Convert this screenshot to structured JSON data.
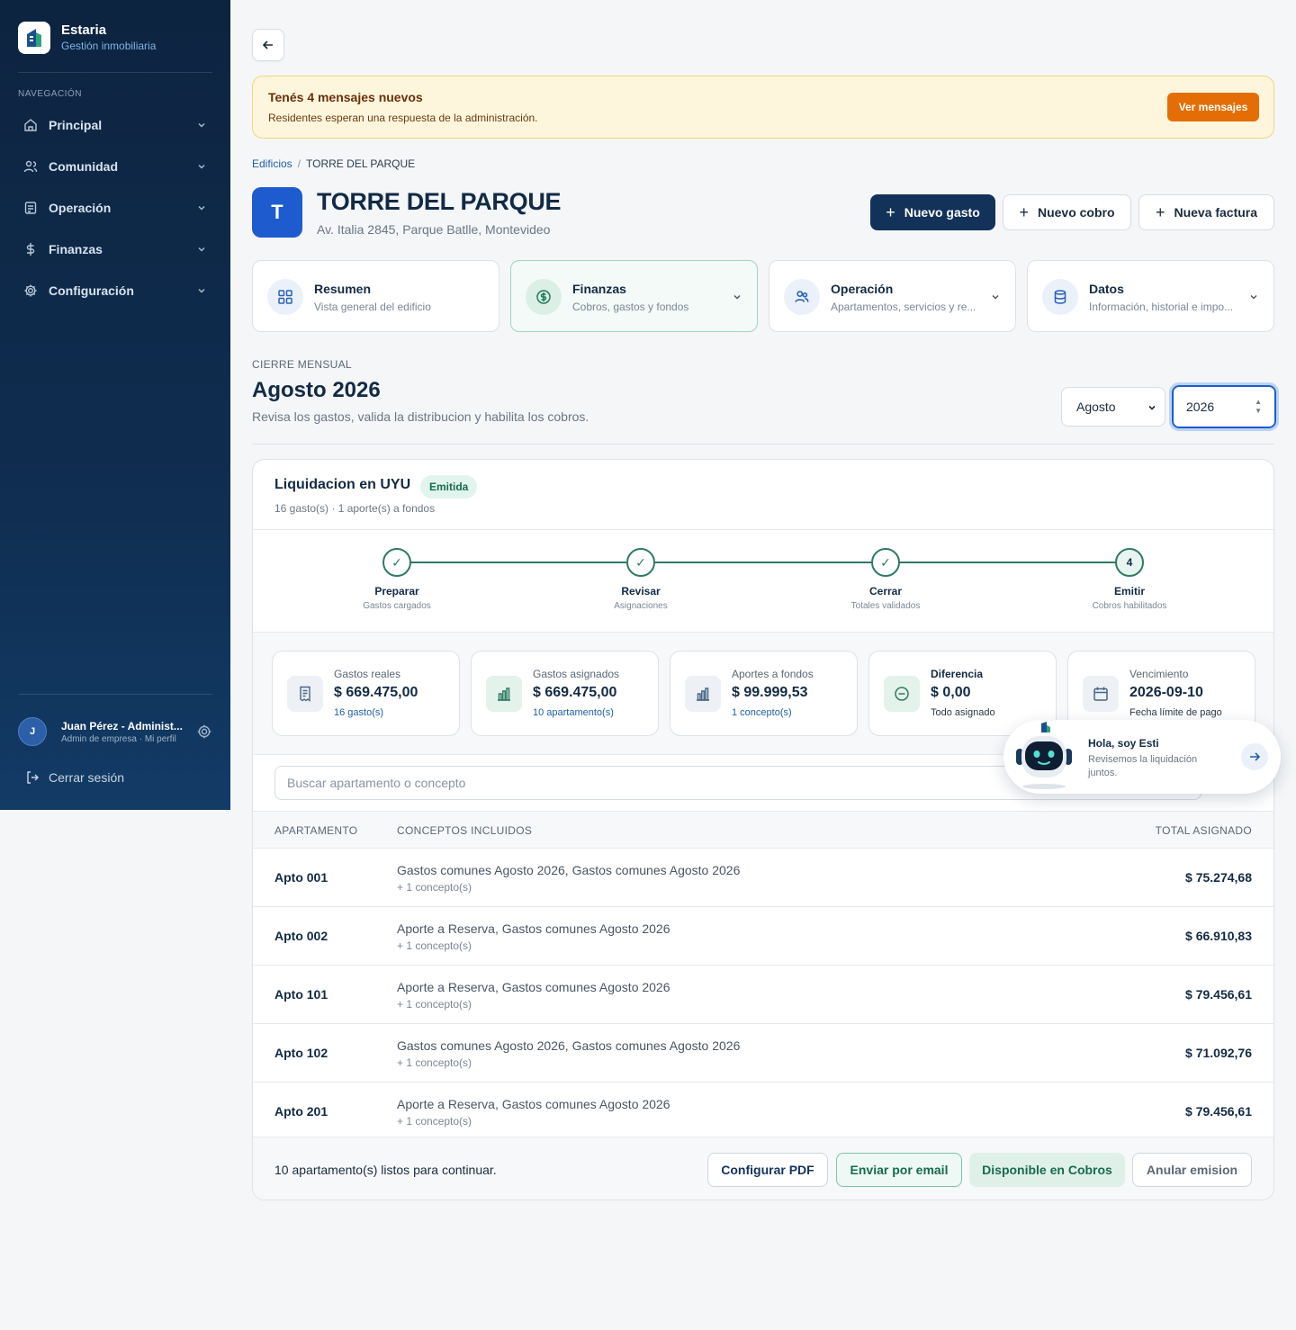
{
  "brand": {
    "name": "Estaria",
    "subtitle": "Gestión inmobiliaria"
  },
  "sidebar": {
    "section_label": "NAVEGACIÓN",
    "items": [
      {
        "label": "Principal",
        "icon": "home-icon"
      },
      {
        "label": "Comunidad",
        "icon": "users-icon"
      },
      {
        "label": "Operación",
        "icon": "clipboard-icon"
      },
      {
        "label": "Finanzas",
        "icon": "dollar-icon"
      },
      {
        "label": "Configuración",
        "icon": "gear-icon"
      }
    ],
    "user": {
      "initial": "J",
      "name": "Juan Pérez - Administ...",
      "role": "Admin de empresa · Mi perfil"
    },
    "logout_label": "Cerrar sesión"
  },
  "alert": {
    "title": "Tenés 4 mensajes nuevos",
    "subtitle": "Residentes esperan una respuesta de la administración.",
    "button": "Ver mensajes"
  },
  "breadcrumb": {
    "root": "Edificios",
    "separator": "/",
    "current": "TORRE DEL PARQUE"
  },
  "building": {
    "initial": "T",
    "name": "TORRE DEL PARQUE",
    "address": "Av. Italia 2845, Parque Batlle, Montevideo"
  },
  "actions": {
    "new_expense": "Nuevo gasto",
    "new_charge": "Nuevo cobro",
    "new_invoice": "Nueva factura"
  },
  "section_cards": [
    {
      "title": "Resumen",
      "subtitle": "Vista general del edificio",
      "icon": "grid-icon"
    },
    {
      "title": "Finanzas",
      "subtitle": "Cobros, gastos y fondos",
      "icon": "dollar-circle-icon"
    },
    {
      "title": "Operación",
      "subtitle": "Apartamentos, servicios y re...",
      "icon": "users-icon"
    },
    {
      "title": "Datos",
      "subtitle": "Información, historial e impo...",
      "icon": "database-icon"
    }
  ],
  "closing": {
    "label": "CIERRE MENSUAL",
    "title": "Agosto 2026",
    "subtitle": "Revisa los gastos, valida la distribucion y habilita los cobros.",
    "month": "Agosto",
    "year": "2026"
  },
  "settlement": {
    "title": "Liquidacion en UYU",
    "status": "Emitida",
    "summary": "16 gasto(s) · 1 aporte(s) a fondos",
    "steps": [
      {
        "marker": "✓",
        "label": "Preparar",
        "sub": "Gastos cargados"
      },
      {
        "marker": "✓",
        "label": "Revisar",
        "sub": "Asignaciones"
      },
      {
        "marker": "✓",
        "label": "Cerrar",
        "sub": "Totales validados"
      },
      {
        "marker": "4",
        "label": "Emitir",
        "sub": "Cobros habilitados"
      }
    ],
    "kpis": [
      {
        "label": "Gastos reales",
        "value": "$ 669.475,00",
        "sub": "16 gasto(s)",
        "icon": "receipt-icon"
      },
      {
        "label": "Gastos asignados",
        "value": "$ 669.475,00",
        "sub": "10 apartamento(s)",
        "icon": "bar-chart-icon"
      },
      {
        "label": "Aportes a fondos",
        "value": "$ 99.999,53",
        "sub": "1 concepto(s)",
        "icon": "bar-chart-icon"
      },
      {
        "label": "Diferencia",
        "value": "$ 0,00",
        "sub": "Todo asignado",
        "icon": "minus-circle-icon"
      },
      {
        "label": "Vencimiento",
        "value": "2026-09-10",
        "sub": "Fecha límite de pago",
        "icon": "calendar-icon"
      }
    ],
    "search_placeholder": "Buscar apartamento o concepto",
    "columns": {
      "apartment": "APARTAMENTO",
      "concepts": "CONCEPTOS INCLUIDOS",
      "total": "TOTAL ASIGNADO"
    },
    "rows": [
      {
        "apartment": "Apto 001",
        "concepts": "Gastos comunes Agosto 2026, Gastos comunes Agosto 2026",
        "more": "+ 1 concepto(s)",
        "total": "$ 75.274,68"
      },
      {
        "apartment": "Apto 002",
        "concepts": "Aporte a Reserva, Gastos comunes Agosto 2026",
        "more": "+ 1 concepto(s)",
        "total": "$ 66.910,83"
      },
      {
        "apartment": "Apto 101",
        "concepts": "Aporte a Reserva, Gastos comunes Agosto 2026",
        "more": "+ 1 concepto(s)",
        "total": "$ 79.456,61"
      },
      {
        "apartment": "Apto 102",
        "concepts": "Gastos comunes Agosto 2026, Gastos comunes Agosto 2026",
        "more": "+ 1 concepto(s)",
        "total": "$ 71.092,76"
      },
      {
        "apartment": "Apto 201",
        "concepts": "Aporte a Reserva, Gastos comunes Agosto 2026",
        "more": "+ 1 concepto(s)",
        "total": "$ 79.456,61"
      }
    ],
    "footer_text": "10 apartamento(s) listos para continuar.",
    "footer_buttons": {
      "pdf": "Configurar PDF",
      "email": "Enviar por email",
      "available": "Disponible en Cobros",
      "cancel": "Anular emision"
    }
  },
  "assistant": {
    "title": "Hola, soy Esti",
    "subtitle": "Revisemos la liquidación juntos."
  },
  "colors": {
    "sidebar": "#0d2440",
    "primary": "#13325a",
    "accent_green": "#2f7a62",
    "alert_button": "#e46e05",
    "brand_blue": "#1d5bcf"
  }
}
